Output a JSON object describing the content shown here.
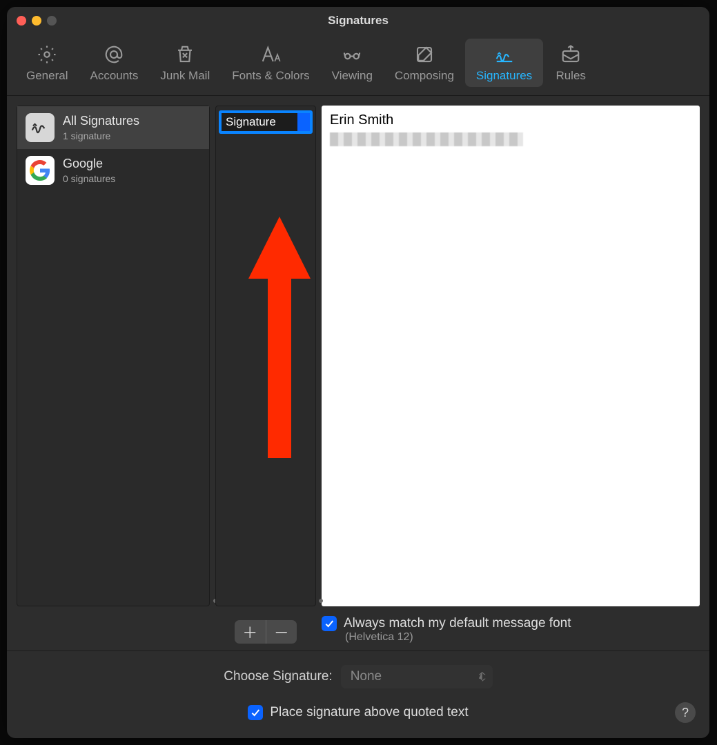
{
  "window": {
    "title": "Signatures"
  },
  "toolbar": {
    "tabs": [
      {
        "id": "general",
        "label": "General"
      },
      {
        "id": "accounts",
        "label": "Accounts"
      },
      {
        "id": "junk",
        "label": "Junk Mail"
      },
      {
        "id": "fonts",
        "label": "Fonts & Colors"
      },
      {
        "id": "viewing",
        "label": "Viewing"
      },
      {
        "id": "composing",
        "label": "Composing"
      },
      {
        "id": "signatures",
        "label": "Signatures",
        "selected": true
      },
      {
        "id": "rules",
        "label": "Rules"
      }
    ]
  },
  "accounts": [
    {
      "id": "all",
      "name": "All Signatures",
      "sub": "1 signature",
      "selected": true
    },
    {
      "id": "google",
      "name": "Google",
      "sub": "0 signatures",
      "selected": false
    }
  ],
  "signatures": {
    "editing_name": "Signature"
  },
  "preview": {
    "name": "Erin Smith"
  },
  "options": {
    "always_match_label": "Always match my default message font",
    "always_match_checked": true,
    "font_note": "(Helvetica 12)"
  },
  "choose": {
    "label": "Choose Signature:",
    "selected": "None"
  },
  "place_above": {
    "label": "Place signature above quoted text",
    "checked": true
  }
}
